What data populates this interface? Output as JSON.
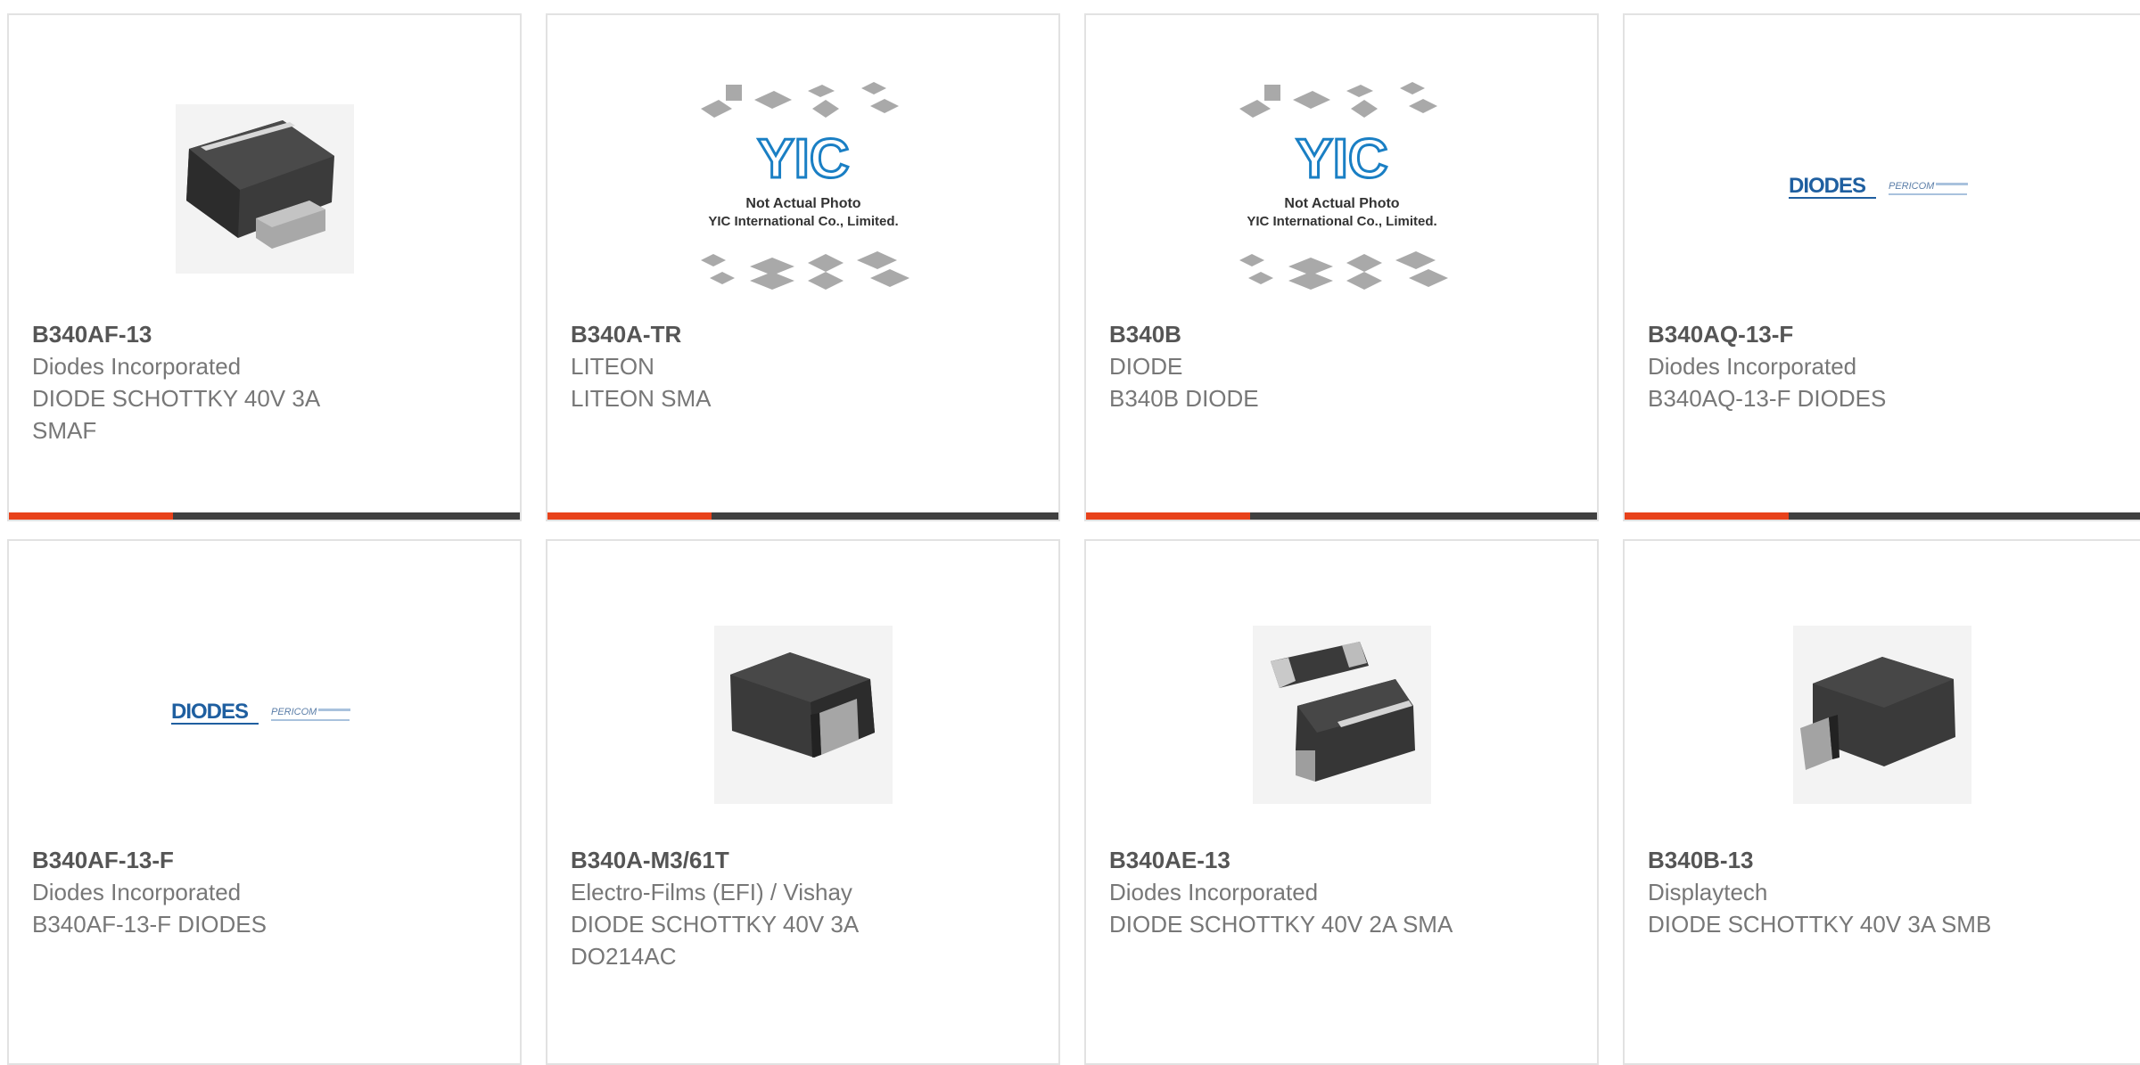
{
  "colors": {
    "accent": "#e8421b",
    "bar": "#404040",
    "border": "#e2e2e2",
    "part": "#555555",
    "text": "#777777"
  },
  "products": [
    {
      "part_number": "B340AF-13",
      "manufacturer": "Diodes Incorporated",
      "description_lines": [
        "DIODE SCHOTTKY 40V 3A",
        "SMAF"
      ],
      "image": "smaf-package-icon"
    },
    {
      "part_number": "B340A-TR",
      "manufacturer": "LITEON",
      "description_lines": [
        "LITEON SMA"
      ],
      "image": "yic-placeholder-image",
      "placeholder": {
        "logo": "YIC",
        "line1": "Not Actual Photo",
        "line2": "YIC International Co., Limited."
      }
    },
    {
      "part_number": "B340B",
      "manufacturer": "DIODE",
      "description_lines": [
        "B340B DIODE"
      ],
      "image": "yic-placeholder-image",
      "placeholder": {
        "logo": "YIC",
        "line1": "Not Actual Photo",
        "line2": "YIC International Co., Limited."
      }
    },
    {
      "part_number": "B340AQ-13-F",
      "manufacturer": "Diodes Incorporated",
      "description_lines": [
        "B340AQ-13-F DIODES"
      ],
      "image": "diodes-logo",
      "logo": {
        "brand": "DIODES",
        "sub": "PERICOM"
      }
    },
    {
      "part_number": "B340AF-13-F",
      "manufacturer": "Diodes Incorporated",
      "description_lines": [
        "B340AF-13-F DIODES"
      ],
      "image": "diodes-logo",
      "logo": {
        "brand": "DIODES",
        "sub": "PERICOM"
      }
    },
    {
      "part_number": "B340A-M3/61T",
      "manufacturer": "Electro-Films (EFI) / Vishay",
      "description_lines": [
        "DIODE SCHOTTKY 40V 3A",
        "DO214AC"
      ],
      "image": "do214ac-package-icon"
    },
    {
      "part_number": "B340AE-13",
      "manufacturer": "Diodes Incorporated",
      "description_lines": [
        "DIODE SCHOTTKY 40V 2A SMA"
      ],
      "image": "sma-pair-package-icon"
    },
    {
      "part_number": "B340B-13",
      "manufacturer": "Displaytech",
      "description_lines": [
        "DIODE SCHOTTKY 40V 3A SMB"
      ],
      "image": "smb-package-icon"
    }
  ]
}
